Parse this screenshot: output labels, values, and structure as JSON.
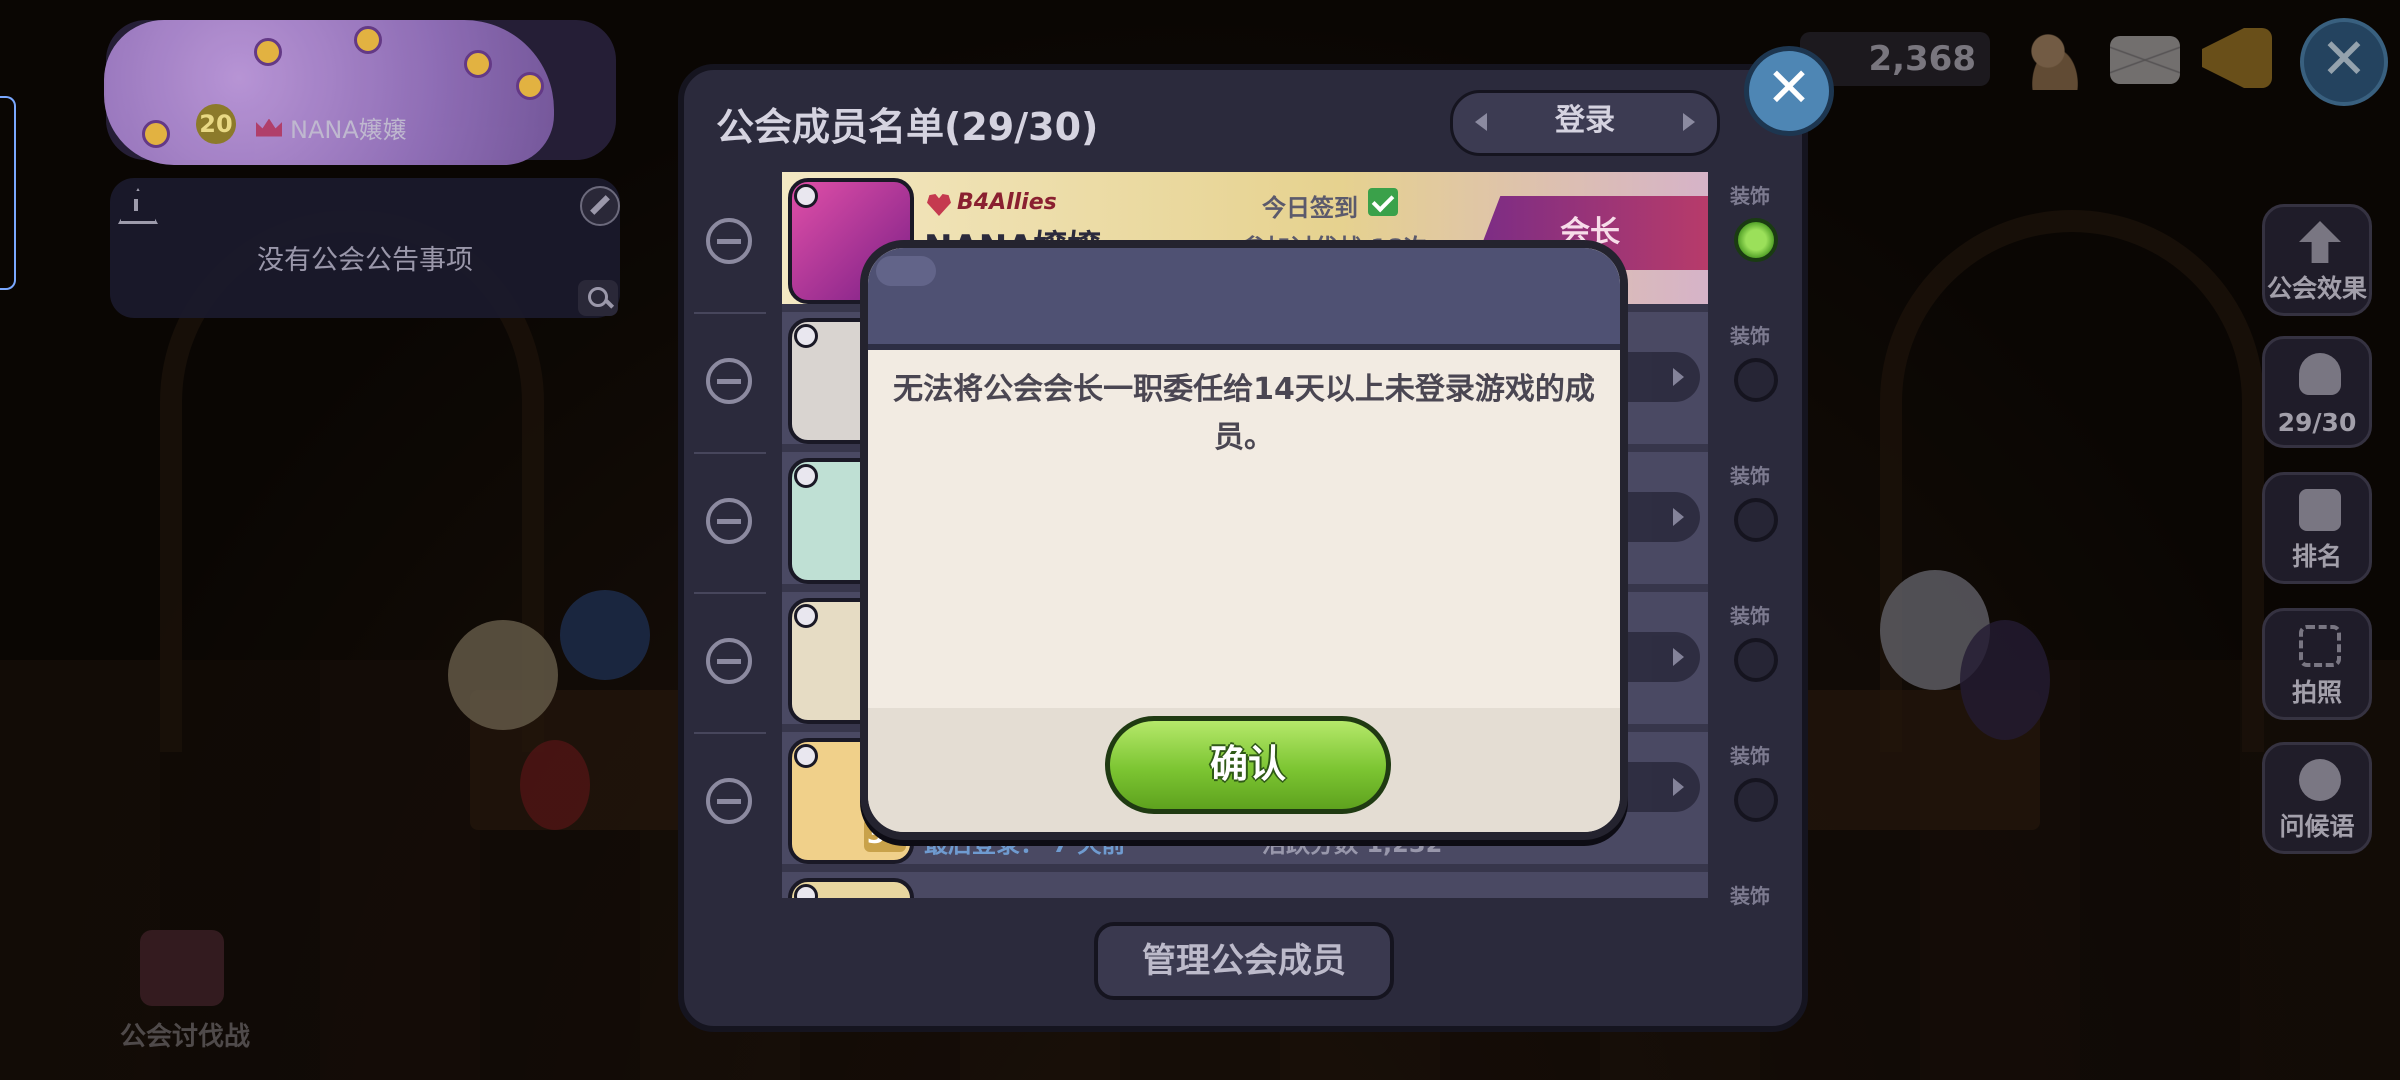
{
  "guild": {
    "level": "20",
    "master_name": "NANA嬢嬢",
    "notice": "没有公会公告事项",
    "raid_label": "公会讨伐战"
  },
  "hud": {
    "currency_value": "2,368",
    "close_symbol": "✕"
  },
  "side_menu": [
    {
      "label": "公会效果",
      "icon": "upgrade-arrow-icon"
    },
    {
      "label": "29/30",
      "icon": "person-icon"
    },
    {
      "label": "排名",
      "icon": "podium-icon"
    },
    {
      "label": "拍照",
      "icon": "camera-frame-icon"
    },
    {
      "label": "问候语",
      "icon": "speech-bubble-gear-icon"
    }
  ],
  "panel": {
    "title": "公会成员名单(29/30)",
    "sort_label": "登录",
    "close_symbol": "✕",
    "manage_button": "管理公会成员",
    "equip_label": "装饰"
  },
  "members": [
    {
      "guild_tag": "B4Allies",
      "name": "NANA嬢嬢",
      "checkin": "今日签到",
      "raid": "参加讨伐战 18次",
      "role": "会长"
    },
    {
      "last_login": "最后登录： 7 天前",
      "activity": "活跃分数 1,232",
      "level": "30"
    }
  ],
  "dialog": {
    "message": "无法将公会会长一职委任给14天以上未登录游戏的成员。",
    "confirm": "确认"
  },
  "colors": {
    "panel": "#2b2a3c",
    "confirm_green": "#7cc532",
    "dialog_header": "#4f5173",
    "dialog_body": "#f2ebe2"
  }
}
